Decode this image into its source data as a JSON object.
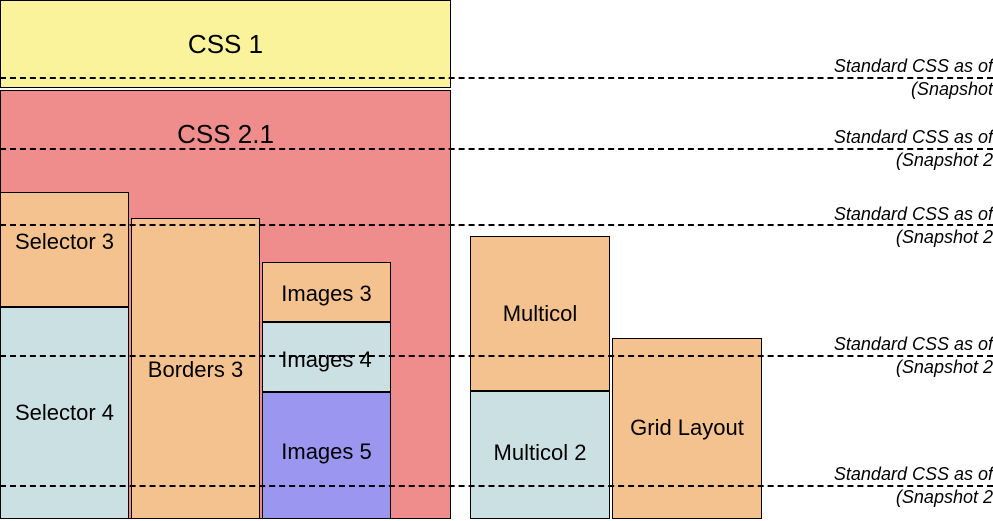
{
  "top_bars": {
    "css1": "CSS 1",
    "css21": "CSS 2.1"
  },
  "columns": {
    "selector3": "Selector 3",
    "selector4": "Selector 4",
    "borders3": "Borders 3",
    "images3": "Images 3",
    "images4": "Images 4",
    "images5": "Images 5",
    "multicol": "Multicol",
    "multicol2": "Multicol 2",
    "grid_layout": "Grid Layout"
  },
  "snapshots": [
    {
      "line1": "Standard CSS as of",
      "line2": "(Snapshot"
    },
    {
      "line1": "Standard CSS as of",
      "line2": "(Snapshot 2"
    },
    {
      "line1": "Standard CSS as of",
      "line2": "(Snapshot 2"
    },
    {
      "line1": "Standard CSS as of",
      "line2": "(Snapshot 2"
    },
    {
      "line1": "Standard CSS as of",
      "line2": "(Snapshot 2"
    }
  ]
}
